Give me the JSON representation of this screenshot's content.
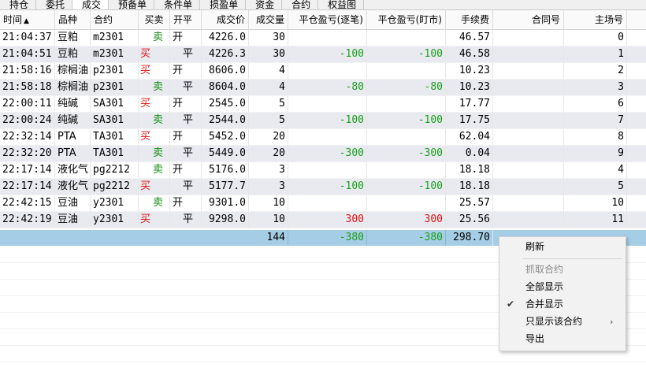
{
  "tabs": [
    {
      "label": "持仓",
      "active": false
    },
    {
      "label": "委托",
      "active": false
    },
    {
      "label": "成交",
      "active": true
    },
    {
      "label": "预备单",
      "active": false
    },
    {
      "label": "条件单",
      "active": false
    },
    {
      "label": "损盈单",
      "active": false
    },
    {
      "label": "资金",
      "active": false
    },
    {
      "label": "合约",
      "active": false
    },
    {
      "label": "权益图",
      "active": false
    }
  ],
  "columns": {
    "time": "时间",
    "sort_indicator": "▲",
    "product": "品种",
    "contract": "合约",
    "direction": "买卖",
    "open_close": "开平",
    "price": "成交价",
    "volume": "成交量",
    "pnl_per_trade": "平仓盈亏(逐笔)",
    "pnl_mark": "平仓盈亏(盯市)",
    "fee": "手续费",
    "contract_no": "合同号",
    "main_no": "主场号"
  },
  "rows": [
    {
      "time": "21:04:37",
      "product": "豆粕",
      "contract": "m2301",
      "dir": "卖",
      "dir_type": "sell",
      "oc": "开",
      "oc_pos": "left",
      "price": "4226.0",
      "volume": "30",
      "pnl1": "",
      "pnl2": "",
      "pnl_type": "",
      "fee": "46.57",
      "contract_no": "",
      "main_no": "0"
    },
    {
      "time": "21:04:51",
      "product": "豆粕",
      "contract": "m2301",
      "dir": "买",
      "dir_type": "buy",
      "oc": "平",
      "oc_pos": "right",
      "price": "4226.3",
      "volume": "30",
      "pnl1": "-100",
      "pnl2": "-100",
      "pnl_type": "neg",
      "fee": "46.58",
      "contract_no": "",
      "main_no": "1"
    },
    {
      "time": "21:58:16",
      "product": "棕榈油",
      "contract": "p2301",
      "dir": "买",
      "dir_type": "buy",
      "oc": "开",
      "oc_pos": "left",
      "price": "8606.0",
      "volume": "4",
      "pnl1": "",
      "pnl2": "",
      "pnl_type": "",
      "fee": "10.23",
      "contract_no": "",
      "main_no": "2"
    },
    {
      "time": "21:58:18",
      "product": "棕榈油",
      "contract": "p2301",
      "dir": "卖",
      "dir_type": "sell",
      "oc": "平",
      "oc_pos": "right",
      "price": "8604.0",
      "volume": "4",
      "pnl1": "-80",
      "pnl2": "-80",
      "pnl_type": "neg",
      "fee": "10.23",
      "contract_no": "",
      "main_no": "3"
    },
    {
      "time": "22:00:11",
      "product": "纯碱",
      "contract": "SA301",
      "dir": "买",
      "dir_type": "buy",
      "oc": "开",
      "oc_pos": "left",
      "price": "2545.0",
      "volume": "5",
      "pnl1": "",
      "pnl2": "",
      "pnl_type": "",
      "fee": "17.77",
      "contract_no": "",
      "main_no": "6"
    },
    {
      "time": "22:00:24",
      "product": "纯碱",
      "contract": "SA301",
      "dir": "卖",
      "dir_type": "sell",
      "oc": "平",
      "oc_pos": "right",
      "price": "2544.0",
      "volume": "5",
      "pnl1": "-100",
      "pnl2": "-100",
      "pnl_type": "neg",
      "fee": "17.75",
      "contract_no": "",
      "main_no": "7"
    },
    {
      "time": "22:32:14",
      "product": "PTA",
      "contract": "TA301",
      "dir": "买",
      "dir_type": "buy",
      "oc": "开",
      "oc_pos": "left",
      "price": "5452.0",
      "volume": "20",
      "pnl1": "",
      "pnl2": "",
      "pnl_type": "",
      "fee": "62.04",
      "contract_no": "",
      "main_no": "8"
    },
    {
      "time": "22:32:20",
      "product": "PTA",
      "contract": "TA301",
      "dir": "卖",
      "dir_type": "sell",
      "oc": "平",
      "oc_pos": "right",
      "price": "5449.0",
      "volume": "20",
      "pnl1": "-300",
      "pnl2": "-300",
      "pnl_type": "neg",
      "fee": "0.04",
      "contract_no": "",
      "main_no": "9"
    },
    {
      "time": "22:17:14",
      "product": "液化气",
      "contract": "pg2212",
      "dir": "卖",
      "dir_type": "sell",
      "oc": "开",
      "oc_pos": "left",
      "price": "5176.0",
      "volume": "3",
      "pnl1": "",
      "pnl2": "",
      "pnl_type": "",
      "fee": "18.18",
      "contract_no": "",
      "main_no": "4"
    },
    {
      "time": "22:17:14",
      "product": "液化气",
      "contract": "pg2212",
      "dir": "买",
      "dir_type": "buy",
      "oc": "平",
      "oc_pos": "right",
      "price": "5177.7",
      "volume": "3",
      "pnl1": "-100",
      "pnl2": "-100",
      "pnl_type": "neg",
      "fee": "18.18",
      "contract_no": "",
      "main_no": "5"
    },
    {
      "time": "22:42:15",
      "product": "豆油",
      "contract": "y2301",
      "dir": "卖",
      "dir_type": "sell",
      "oc": "开",
      "oc_pos": "left",
      "price": "9301.0",
      "volume": "10",
      "pnl1": "",
      "pnl2": "",
      "pnl_type": "",
      "fee": "25.57",
      "contract_no": "",
      "main_no": "10"
    },
    {
      "time": "22:42:19",
      "product": "豆油",
      "contract": "y2301",
      "dir": "买",
      "dir_type": "buy",
      "oc": "平",
      "oc_pos": "right",
      "price": "9298.0",
      "volume": "10",
      "pnl1": "300",
      "pnl2": "300",
      "pnl_type": "pos",
      "fee": "25.56",
      "contract_no": "",
      "main_no": "11"
    }
  ],
  "summary": {
    "volume": "144",
    "pnl1": "-380",
    "pnl2": "-380",
    "fee": "298.70"
  },
  "context_menu": {
    "refresh": "刷新",
    "fetch_contract": "抓取合约",
    "show_all": "全部显示",
    "merge_display": "合并显示",
    "merge_checked": true,
    "only_this_contract": "只显示该合约",
    "export": "导出"
  },
  "colors": {
    "buy": "#e01010",
    "sell": "#109010",
    "summary_bg": "#a6cde6",
    "alt_row_bg": "#e8eaf0"
  }
}
